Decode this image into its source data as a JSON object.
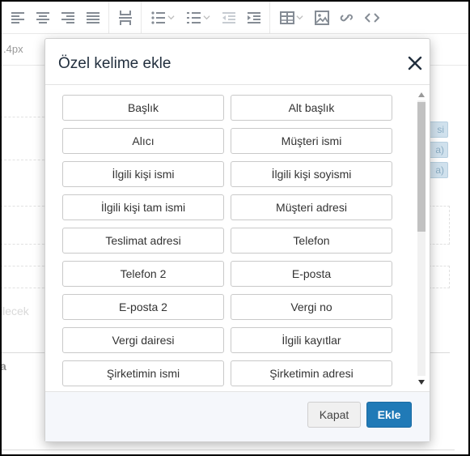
{
  "editor": {
    "font_size_value": ".4px",
    "bg_placeholder_text": "ilecek",
    "bg_bold_text": "a",
    "bg_chip_labels": [
      "si",
      "a)",
      "a)"
    ]
  },
  "dialog": {
    "title": "Özel kelime ekle",
    "words": [
      "Başlık",
      "Alt başlık",
      "Alıcı",
      "Müşteri ismi",
      "İlgili kişi ismi",
      "İlgili kişi soyismi",
      "İlgili kişi tam ismi",
      "Müşteri adresi",
      "Teslimat adresi",
      "Telefon",
      "Telefon 2",
      "E-posta",
      "E-posta 2",
      "Vergi no",
      "Vergi dairesi",
      "İlgili kayıtlar",
      "Şirketimin ismi",
      "Şirketimin adresi"
    ],
    "cancel_label": "Kapat",
    "confirm_label": "Ekle"
  },
  "colors": {
    "primary": "#207ab7",
    "text_dark": "#222f3e",
    "chip_bg": "#a9c9de"
  },
  "icons": {
    "toolbar": [
      "align-left-icon",
      "align-center-icon",
      "align-right-icon",
      "align-justify-icon",
      "page-break-icon",
      "bullet-list-icon",
      "numbered-list-icon",
      "outdent-icon",
      "indent-icon",
      "table-icon",
      "image-icon",
      "link-icon",
      "code-icon"
    ],
    "close": "close-icon"
  }
}
